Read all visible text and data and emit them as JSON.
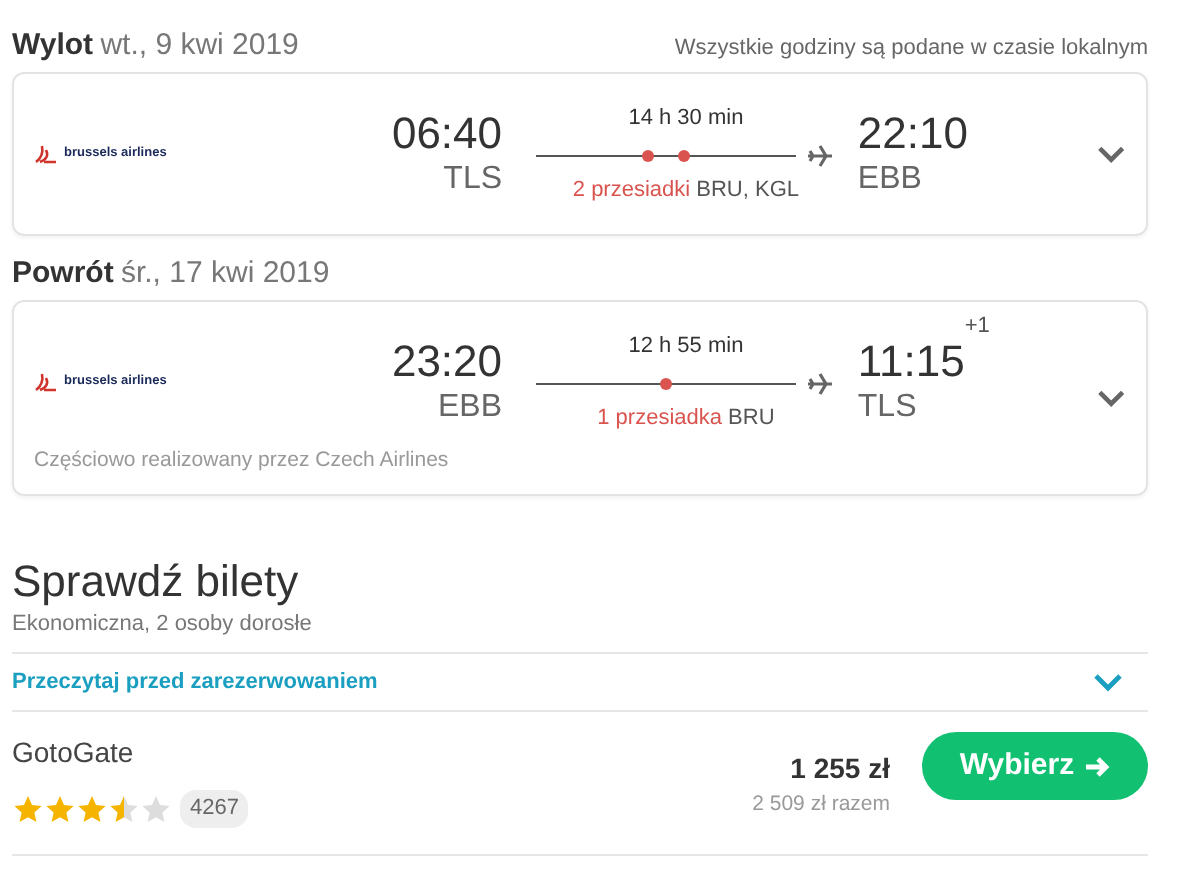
{
  "timezone_note": "Wszystkie godziny są podane w czasie lokalnym",
  "legs": [
    {
      "label": "Wylot",
      "date": "wt., 9 kwi 2019",
      "airline": "brussels airlines",
      "depart_time": "06:40",
      "depart_airport": "TLS",
      "duration": "14 h 30 min",
      "stops_label": "2 przesiadki",
      "via": "BRU, KGL",
      "arrive_time": "22:10",
      "arrive_airport": "EBB"
    },
    {
      "label": "Powrót",
      "date": "śr., 17 kwi 2019",
      "airline": "brussels airlines",
      "depart_time": "23:20",
      "depart_airport": "EBB",
      "duration": "12 h 55 min",
      "stops_label": "1 przesiadka",
      "via": "BRU",
      "arrive_time": "11:15",
      "day_offset": "+1",
      "arrive_airport": "TLS",
      "note": "Częściowo realizowany przez Czech Airlines"
    }
  ],
  "tickets": {
    "title": "Sprawdź bilety",
    "subtitle": "Ekonomiczna, 2 osoby dorosłe",
    "read_link": "Przeczytaj przed zarezerwowaniem",
    "offers": [
      {
        "provider": "GotoGate",
        "stars": 3.5,
        "reviews": "4267",
        "price": "1 255 zł",
        "total": "2 509 zł razem",
        "button": "Wybierz"
      }
    ]
  }
}
